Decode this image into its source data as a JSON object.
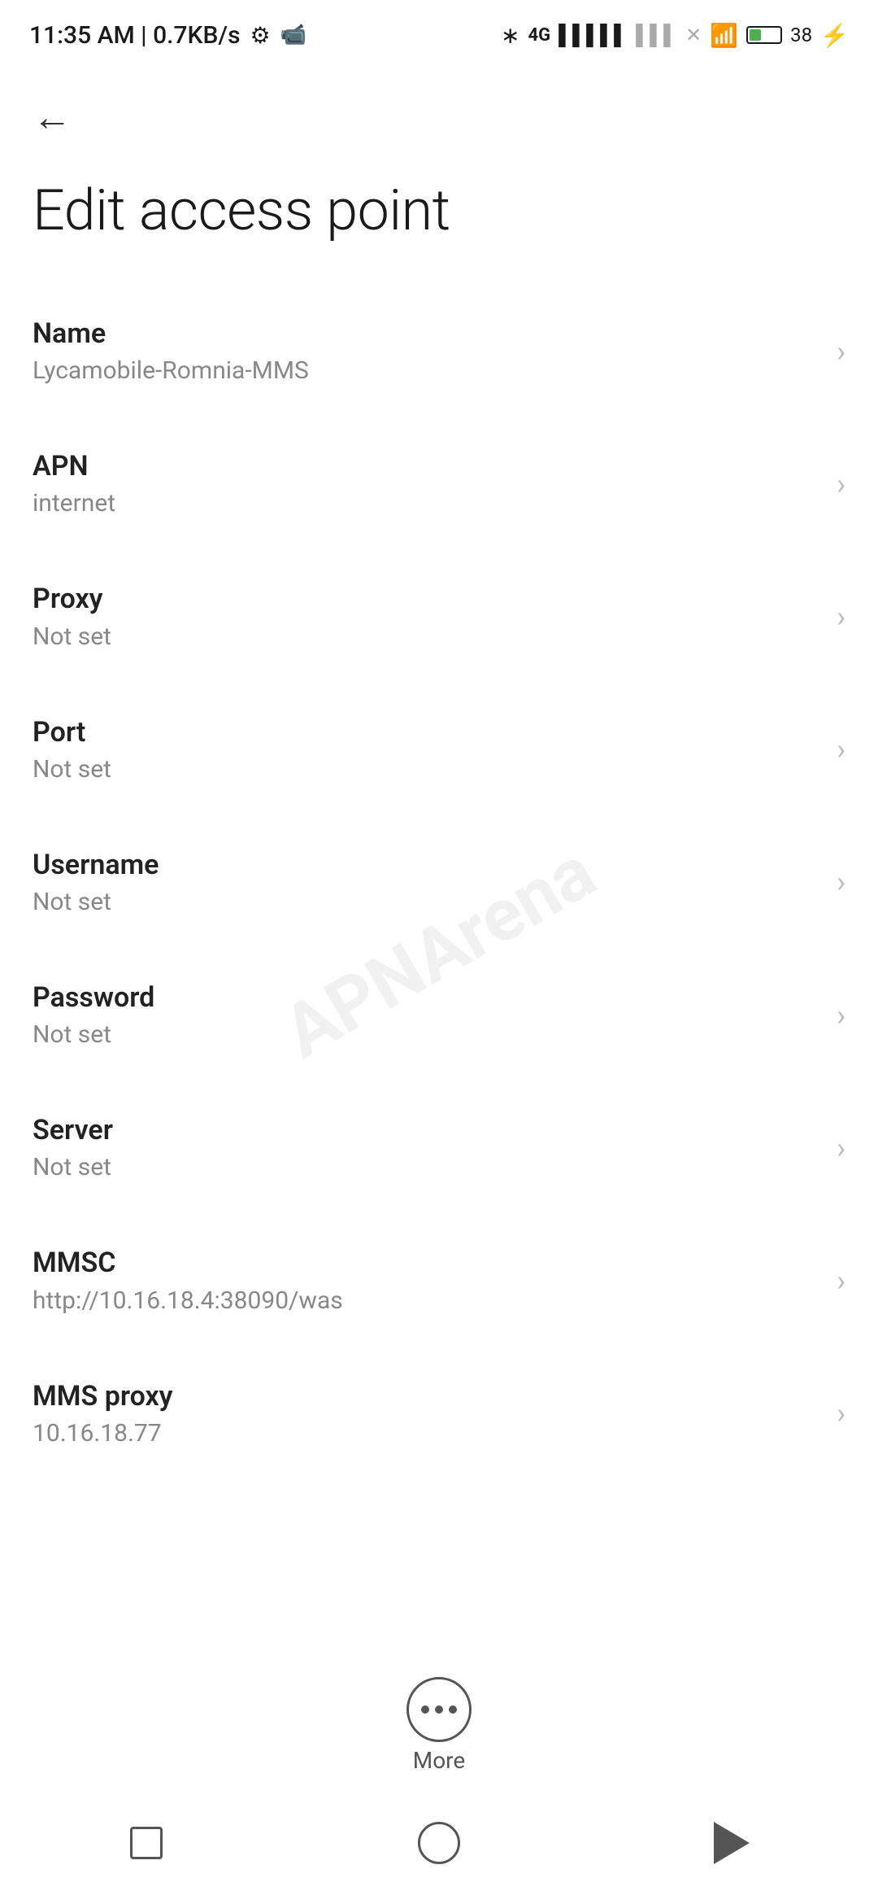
{
  "status": {
    "time": "11:35 AM | 0.7KB/s",
    "battery_percent": "38"
  },
  "toolbar": {
    "back_label": "←"
  },
  "page": {
    "title": "Edit access point"
  },
  "settings": {
    "items": [
      {
        "label": "Name",
        "value": "Lycamobile-Romnia-MMS"
      },
      {
        "label": "APN",
        "value": "internet"
      },
      {
        "label": "Proxy",
        "value": "Not set"
      },
      {
        "label": "Port",
        "value": "Not set"
      },
      {
        "label": "Username",
        "value": "Not set"
      },
      {
        "label": "Password",
        "value": "Not set"
      },
      {
        "label": "Server",
        "value": "Not set"
      },
      {
        "label": "MMSC",
        "value": "http://10.16.18.4:38090/was"
      },
      {
        "label": "MMS proxy",
        "value": "10.16.18.77"
      }
    ]
  },
  "more_button": {
    "label": "More"
  },
  "watermark": {
    "text": "APNArena"
  }
}
